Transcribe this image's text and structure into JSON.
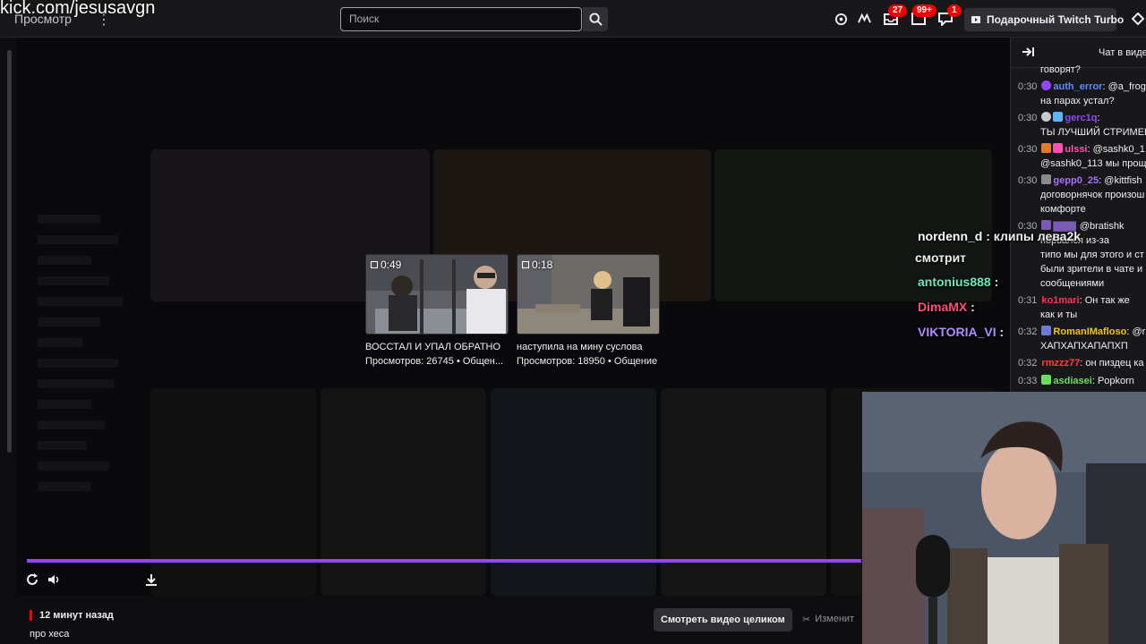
{
  "overlay_url": "kick.com/jesusavgn",
  "topbar": {
    "browse_label": "Просмотр",
    "search_placeholder": "Поиск",
    "badges": {
      "inbox": "27",
      "messages": "99+",
      "whispers": "1"
    },
    "turbo_label": "Подарочный Twitch Turbo"
  },
  "clips": [
    {
      "duration": "0:49",
      "title": "ВОССТАЛ И УПАЛ ОБРАТНО",
      "views": "Просмотров: 26745 • Общен..."
    },
    {
      "duration": "0:18",
      "title": "наступила на мину суслова",
      "views": "Просмотров: 18950 • Общение"
    }
  ],
  "video": {
    "progress": 1.0
  },
  "info": {
    "time_ago": "12 минут назад",
    "description": "про хеса",
    "watch_full_label": "Смотреть видео целиком",
    "edit_label": "Изменит"
  },
  "chat": {
    "title": "Чат в виде",
    "messages": [
      {
        "time": "",
        "user": "",
        "text": "говорят?",
        "color": "#efeff1"
      },
      {
        "time": "0:30",
        "user": "auth_error",
        "text": ": @a_frog",
        "color": "#5c8aff"
      },
      {
        "time": "",
        "user": "",
        "text": "на парах устал?",
        "color": "#efeff1"
      },
      {
        "time": "0:30",
        "user": "gerc1q",
        "text": ":",
        "color": "#9147ff"
      },
      {
        "time": "",
        "user": "",
        "text": "ТЫ ЛУЧШИЙ СТРИМЕР",
        "color": "#efeff1"
      },
      {
        "time": "0:30",
        "user": "ulssi",
        "text": ": @sashk0_1",
        "color": "#ff4fb4"
      },
      {
        "time": "",
        "user": "",
        "text": "@sashk0_113 мы прощ",
        "color": "#efeff1"
      },
      {
        "time": "0:30",
        "user": "gepp0_25",
        "text": ": @kittfish",
        "color": "#a970ff"
      },
      {
        "time": "",
        "user": "",
        "text": "договорнячок произош",
        "color": "#efeff1"
      },
      {
        "time": "",
        "user": "",
        "text": "комфорте",
        "color": "#efeff1"
      },
      {
        "time": "0:30",
        "user": "",
        "text": "@bratishk",
        "color": "#efeff1"
      },
      {
        "time": "",
        "user": "",
        "text": "порвался из-за",
        "color": "#efeff1"
      },
      {
        "time": "",
        "user": "",
        "text": "типо мы для этого и ст",
        "color": "#efeff1"
      },
      {
        "time": "",
        "user": "",
        "text": "были зрители в чате и",
        "color": "#efeff1"
      },
      {
        "time": "",
        "user": "",
        "text": "сообщениями",
        "color": "#efeff1"
      },
      {
        "time": "0:31",
        "user": "ko1mari",
        "text": ": Он так же",
        "color": "#ff3355"
      },
      {
        "time": "",
        "user": "",
        "text": "как и ты",
        "color": "#efeff1"
      },
      {
        "time": "0:32",
        "user": "RomanIMafloso",
        "text": ": @r",
        "color": "#f0c419"
      },
      {
        "time": "",
        "user": "",
        "text": "ХАПХАПХАПАПХП",
        "color": "#efeff1"
      },
      {
        "time": "0:32",
        "user": "rmzzz77",
        "text": ": он пиздец ка",
        "color": "#ff4040"
      },
      {
        "time": "0:33",
        "user": "asdiasei",
        "text": ": Popkorn",
        "color": "#69e05d"
      }
    ]
  },
  "overlay_chat": [
    {
      "user": "nordenn_d",
      "text": ": клипы лева2k",
      "color": "#ffffff"
    },
    {
      "user": "",
      "text": "смотрит",
      "color": "#ffffff"
    },
    {
      "user": "antonius888",
      "text": ":",
      "color": "#6fe8c2"
    },
    {
      "user": "DimaMX",
      "text": ":",
      "color": "#ff4d7a"
    },
    {
      "user": "VIKTORIA_VI",
      "text": ":",
      "color": "#b28cff"
    }
  ]
}
